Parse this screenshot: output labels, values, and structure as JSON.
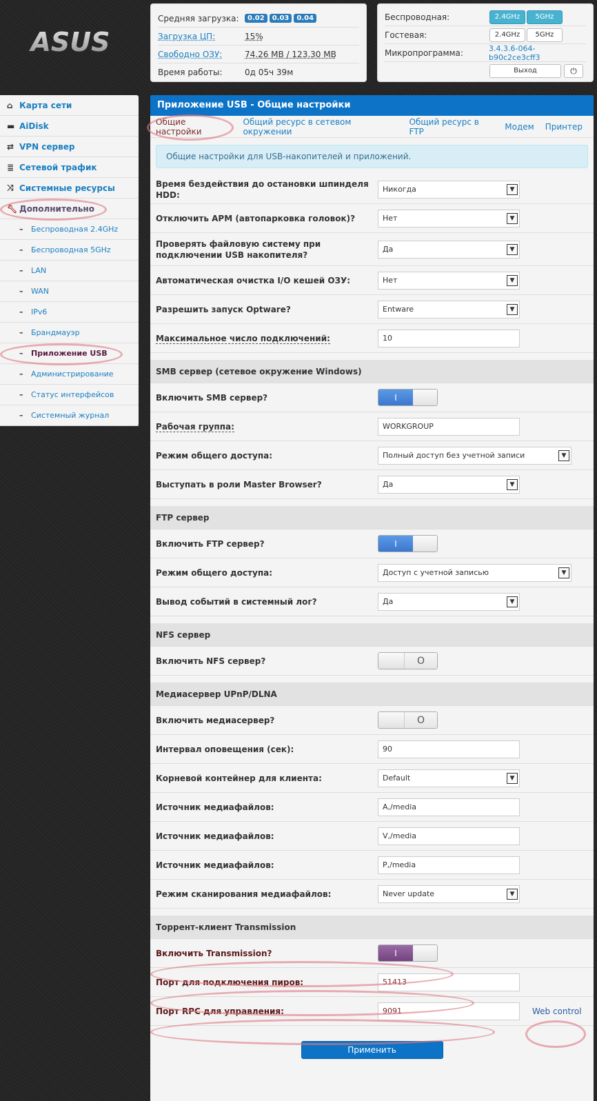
{
  "logo": {
    "text": "ASUS"
  },
  "status": {
    "load_label": "Средняя загрузка:",
    "load_values": [
      "0.02",
      "0.03",
      "0.04"
    ],
    "cpu_label": "Загрузка ЦП:",
    "cpu_value": "15%",
    "ram_label": "Свободно ОЗУ:",
    "ram_value": "74.26 MB / 123.30 MB",
    "uptime_label": "Время работы:",
    "uptime_value": "0д 05ч 39м"
  },
  "wireless": {
    "wireless_label": "Беспроводная:",
    "guest_label": "Гостевая:",
    "firmware_label": "Микропрограмма:",
    "band_24": "2.4GHz",
    "band_5": "5GHz",
    "firmware_value": "3.4.3.6-064-b90c2ce3cff3",
    "logout": "Выход",
    "power_icon": "power-icon"
  },
  "sidebar": {
    "items": [
      {
        "label": "Карта сети",
        "icon": "home-icon"
      },
      {
        "label": "AiDisk",
        "icon": "disk-icon"
      },
      {
        "label": "VPN сервер",
        "icon": "vpn-icon"
      },
      {
        "label": "Сетевой трафик",
        "icon": "traffic-icon"
      },
      {
        "label": "Системные ресурсы",
        "icon": "shuffle-icon"
      },
      {
        "label": "Дополнительно",
        "icon": "wrench-icon"
      }
    ],
    "subitems": [
      "Беспроводная 2.4GHz",
      "Беспроводная 5GHz",
      "LAN",
      "WAN",
      "IPv6",
      "Брандмауэр",
      "Приложение USB",
      "Администрирование",
      "Статус интерфейсов",
      "Системный журнал"
    ]
  },
  "main": {
    "title": "Приложение USB - Общие настройки",
    "tabs": [
      "Общие настройки",
      "Общий ресурс в сетевом окружении",
      "Общий ресурс в FTP",
      "Модем",
      "Принтер"
    ],
    "info": "Общие настройки для USB-накопителей и приложений.",
    "general": {
      "hdd_label": "Время бездействия до остановки шпинделя HDD:",
      "hdd_value": "Никогда",
      "apm_label": "Отключить APM (автопарковка головок)?",
      "apm_value": "Нет",
      "fscheck_label": "Проверять файловую систему при подключении USB накопителя?",
      "fscheck_value": "Да",
      "cache_label": "Автоматическая очистка I/O кешей ОЗУ:",
      "cache_value": "Нет",
      "optware_label": "Разрешить запуск Optware?",
      "optware_value": "Entware",
      "maxconn_label": "Максимальное число подключений:",
      "maxconn_value": "10"
    },
    "smb": {
      "title": "SMB сервер (сетевое окружение Windows)",
      "enable_label": "Включить SMB сервер?",
      "workgroup_label": "Рабочая группа:",
      "workgroup_value": "WORKGROUP",
      "mode_label": "Режим общего доступа:",
      "mode_value": "Полный доступ без учетной записи",
      "master_label": "Выступать в роли Master Browser?",
      "master_value": "Да"
    },
    "ftp": {
      "title": "FTP сервер",
      "enable_label": "Включить FTP сервер?",
      "mode_label": "Режим общего доступа:",
      "mode_value": "Доступ с учетной записью",
      "log_label": "Вывод событий в системный лог?",
      "log_value": "Да"
    },
    "nfs": {
      "title": "NFS сервер",
      "enable_label": "Включить NFS сервер?"
    },
    "dlna": {
      "title": "Медиасервер UPnP/DLNA",
      "enable_label": "Включить медиасервер?",
      "interval_label": "Интервал оповещения (сек):",
      "interval_value": "90",
      "root_label": "Корневой контейнер для клиента:",
      "root_value": "Default",
      "src_label": "Источник медиафайлов:",
      "src1_value": "A,/media",
      "src2_value": "V,/media",
      "src3_value": "P,/media",
      "scan_label": "Режим сканирования медиафайлов:",
      "scan_value": "Never update"
    },
    "transmission": {
      "title": "Торрент-клиент Transmission",
      "enable_label": "Включить Transmission?",
      "peer_label": "Порт для подключения пиров:",
      "peer_value": "51413",
      "rpc_label": "Порт RPC для управления:",
      "rpc_value": "9091",
      "web_control": "Web control"
    },
    "apply": "Применить",
    "toggle_on_glyph": "I",
    "toggle_off_glyph": "O"
  }
}
